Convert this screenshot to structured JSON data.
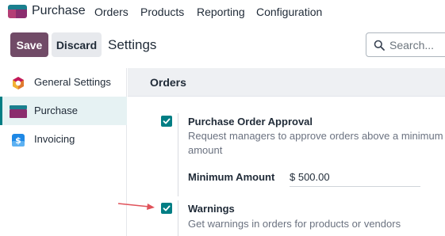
{
  "navbar": {
    "app_name": "Purchase",
    "menu": [
      "Orders",
      "Products",
      "Reporting",
      "Configuration"
    ]
  },
  "control_panel": {
    "save_label": "Save",
    "discard_label": "Discard",
    "title": "Settings",
    "search_placeholder": "Search..."
  },
  "sidebar": {
    "items": [
      {
        "label": "General Settings",
        "icon": "odoo-logo-icon"
      },
      {
        "label": "Purchase",
        "icon": "purchase-app-icon",
        "active": true
      },
      {
        "label": "Invoicing",
        "icon": "invoicing-app-icon"
      }
    ]
  },
  "section": {
    "title": "Orders",
    "settings": [
      {
        "title": "Purchase Order Approval",
        "description": "Request managers to approve orders above a minimum amount",
        "checked": true,
        "field": {
          "label": "Minimum Amount",
          "value": "$ 500.00"
        }
      },
      {
        "title": "Warnings",
        "description": "Get warnings in orders for products or vendors",
        "checked": true
      }
    ]
  },
  "colors": {
    "brand": "#714b67",
    "accent": "#017e84",
    "annotation_arrow": "#e0525a"
  }
}
